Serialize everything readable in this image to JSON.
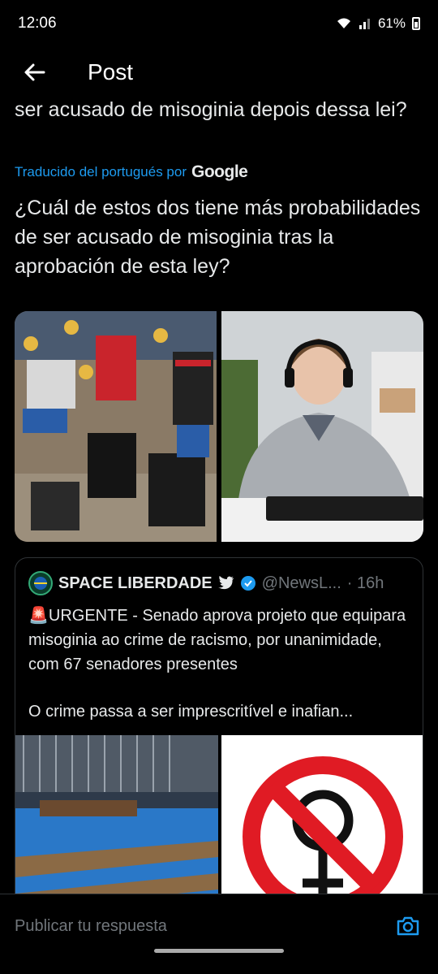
{
  "status": {
    "time": "12:06",
    "battery": "61%"
  },
  "header": {
    "title": "Post"
  },
  "post": {
    "original_text_tail": "ser acusado de misoginia depois dessa lei?",
    "translated_by": "Traducido del portugués por",
    "translator_brand": "Google",
    "translated_text": "¿Cuál de estos dos tiene más probabilidades de ser acusado de misoginia tras la aprobación de esta ley?"
  },
  "quote": {
    "author_name": "SPACE LIBERDADE",
    "handle": "@NewsL...",
    "time": "· 16h",
    "text_line1": "🚨URGENTE - Senado aprova projeto que equipara misoginia ao crime de racismo, por unanimidade, com 67 senadores presentes",
    "text_line2": "O crime passa a ser imprescritível e inafian..."
  },
  "reply": {
    "placeholder": "Publicar tu respuesta"
  },
  "colors": {
    "accent": "#1d9bf0",
    "background": "#000000",
    "text": "#e7e9ea",
    "muted": "#71767b"
  }
}
